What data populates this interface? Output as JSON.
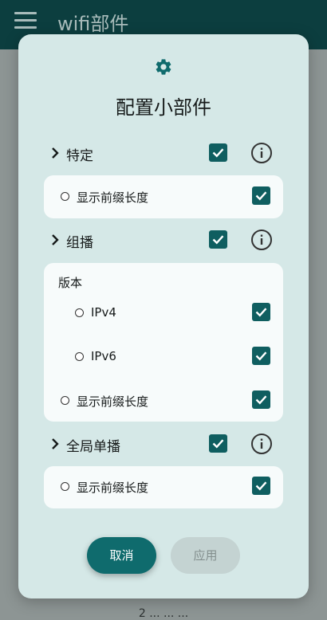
{
  "appbar": {
    "title": "wifi部件"
  },
  "peek_text": "2 ... ... ...",
  "dialog": {
    "title": "配置小部件",
    "sections": [
      {
        "label": "特定",
        "checked": true,
        "rows": [
          {
            "label": "显示前缀长度",
            "checked": true
          }
        ]
      },
      {
        "label": "组播",
        "checked": true,
        "group_label": "版本",
        "versions": [
          {
            "label": "IPv4",
            "checked": true
          },
          {
            "label": "IPv6",
            "checked": true
          }
        ],
        "rows": [
          {
            "label": "显示前缀长度",
            "checked": true
          }
        ]
      },
      {
        "label": "全局单播",
        "checked": true,
        "rows": [
          {
            "label": "显示前缀长度",
            "checked": true
          }
        ]
      }
    ],
    "buttons": {
      "cancel": "取消",
      "apply": "应用"
    }
  },
  "colors": {
    "appbar": "#0c3e3f",
    "dialog_bg": "#d5e8e7",
    "accent": "#0f5e60",
    "card_bg": "#f7fbfb"
  },
  "icons": {
    "menu": "menu-icon",
    "settings": "gear-icon",
    "expand": "chevron-right-icon",
    "info": "info-icon",
    "checkbox": "checkbox-checked-icon",
    "radio": "radio-empty-icon"
  }
}
